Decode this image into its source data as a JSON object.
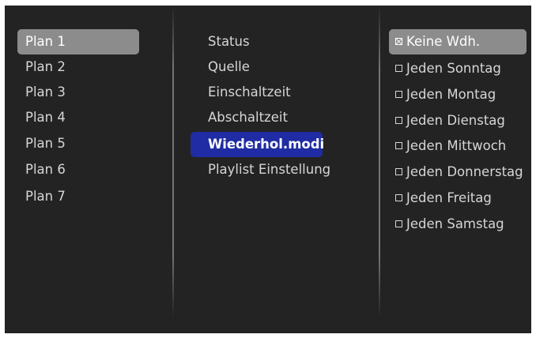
{
  "plans": [
    "Plan 1",
    "Plan 2",
    "Plan 3",
    "Plan 4",
    "Plan 5",
    "Plan 6",
    "Plan 7"
  ],
  "settings": [
    "Status",
    "Quelle",
    "Einschaltzeit",
    "Abschaltzeit",
    "Wiederhol.modi",
    "Playlist Einstellung"
  ],
  "repeat_options": [
    "Keine Wdh.",
    "Jeden Sonntag",
    "Jeden Montag",
    "Jeden Dienstag",
    "Jeden Mittwoch",
    "Jeden Donnerstag",
    "Jeden Freitag",
    "Jeden Samstag"
  ],
  "selected": {
    "plan": "Plan 1",
    "setting": "Wiederhol.modi",
    "repeat_option": "Keine Wdh."
  },
  "colors": {
    "background": "#232323",
    "highlight_grey": "#8c8c8c",
    "highlight_blue": "#1f2ca3",
    "text": "#d6d6d6"
  }
}
